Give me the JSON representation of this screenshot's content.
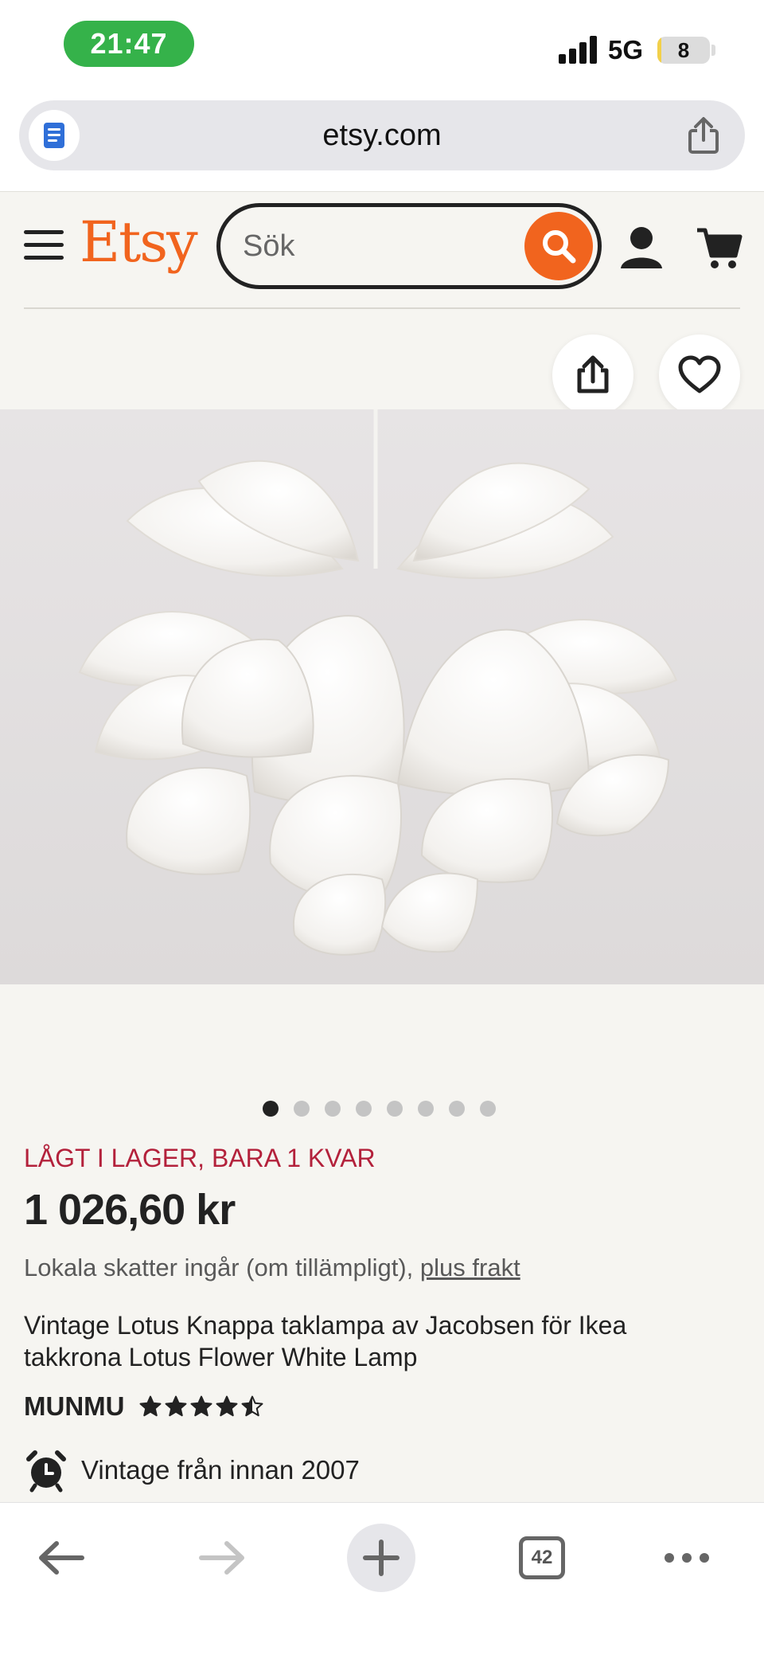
{
  "status_bar": {
    "time": "21:47",
    "network": "5G",
    "battery": "8",
    "battery_level": 0.08
  },
  "browser": {
    "url": "etsy.com",
    "open_tabs": "42"
  },
  "header": {
    "logo": "Etsy",
    "search_placeholder": "Sök"
  },
  "colors": {
    "brand": "#f1641e",
    "stock_warning": "#b3213b",
    "status_pill": "#35b24a"
  },
  "gallery": {
    "image_count": 8,
    "current_index": 0
  },
  "product": {
    "stock_notice": "LÅGT I LAGER, BARA 1 KVAR",
    "price": "1 026,60 kr",
    "tax_text": "Lokala skatter ingår (om tillämpligt), ",
    "shipping_link": "plus frakt",
    "title": "Vintage Lotus Knappa taklampa av Jacobsen för Ikea takkrona Lotus Flower White Lamp",
    "shop_name": "MUNMU",
    "rating": 4.5,
    "vintage_text": "Vintage från innan 2007"
  }
}
